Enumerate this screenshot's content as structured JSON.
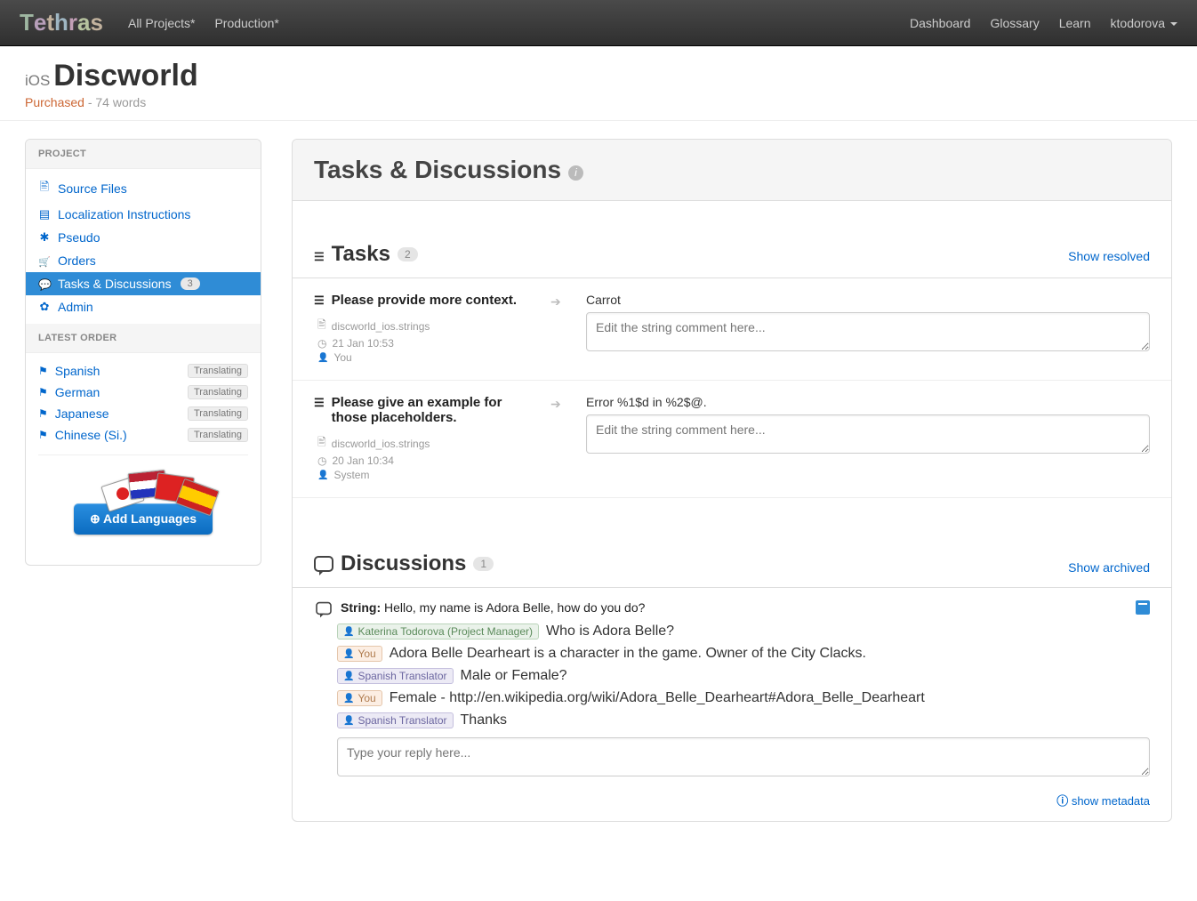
{
  "nav": {
    "brand": "Tethras",
    "left": [
      "All Projects*",
      "Production*"
    ],
    "right": [
      "Dashboard",
      "Glossary",
      "Learn"
    ],
    "user": "ktodorova"
  },
  "header": {
    "prefix": "iOS",
    "title": "Discworld",
    "status": "Purchased",
    "sep": " - ",
    "words": "74 words"
  },
  "sidebar": {
    "project_head": "PROJECT",
    "items": [
      {
        "icon": "ic-file",
        "label": "Source Files"
      },
      {
        "icon": "ic-doc",
        "label": "Localization Instructions"
      },
      {
        "icon": "ic-ast",
        "label": "Pseudo"
      },
      {
        "icon": "ic-cart",
        "label": "Orders"
      },
      {
        "icon": "ic-chat",
        "label": "Tasks & Discussions",
        "badge": "3",
        "active": true
      },
      {
        "icon": "ic-gear",
        "label": "Admin"
      }
    ],
    "latest_head": "LATEST ORDER",
    "langs": [
      {
        "name": "Spanish",
        "status": "Translating"
      },
      {
        "name": "German",
        "status": "Translating"
      },
      {
        "name": "Japanese",
        "status": "Translating"
      },
      {
        "name": "Chinese (Si.)",
        "status": "Translating"
      }
    ],
    "add_btn": "Add Languages"
  },
  "panel": {
    "title": "Tasks & Discussions"
  },
  "tasks_section": {
    "title": "Tasks",
    "count": "2",
    "link": "Show resolved"
  },
  "tasks": [
    {
      "title": "Please provide more context.",
      "file": "discworld_ios.strings",
      "time": "21 Jan 10:53",
      "author": "You",
      "source": "Carrot",
      "placeholder": "Edit the string comment here..."
    },
    {
      "title": "Please give an example for those placeholders.",
      "file": "discworld_ios.strings",
      "time": "20 Jan 10:34",
      "author": "System",
      "source": "Error %1$d in %2$@.",
      "placeholder": "Edit the string comment here..."
    }
  ],
  "disc_section": {
    "title": "Discussions",
    "count": "1",
    "link": "Show archived"
  },
  "discussion": {
    "label": "String:",
    "string": "Hello, my name is Adora Belle, how do you do?",
    "messages": [
      {
        "role": "pm",
        "who": "Katerina Todorova (Project Manager)",
        "text": "Who is Adora Belle?"
      },
      {
        "role": "you",
        "who": "You",
        "text": "Adora Belle Dearheart is a character in the game. Owner of the City Clacks."
      },
      {
        "role": "tr",
        "who": "Spanish Translator",
        "text": "Male or Female?"
      },
      {
        "role": "you",
        "who": "You",
        "text": "Female - http://en.wikipedia.org/wiki/Adora_Belle_Dearheart#Adora_Belle_Dearheart"
      },
      {
        "role": "tr",
        "who": "Spanish Translator",
        "text": "Thanks"
      }
    ],
    "reply_placeholder": "Type your reply here...",
    "meta_link": "show metadata"
  }
}
